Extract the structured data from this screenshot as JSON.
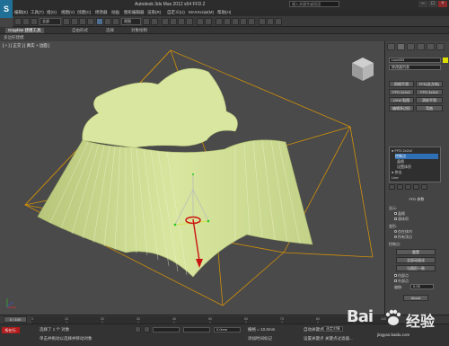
{
  "titlebar": {
    "title": "Autodesk 3ds Max 2012 x64    FFD.2",
    "search_placeholder": "键入关键字或短语",
    "minimize": "–",
    "maximize": "□",
    "close": "×"
  },
  "logo": "S",
  "menubar": [
    "编辑(E)",
    "工具(T)",
    "组(G)",
    "视图(V)",
    "创建(C)",
    "修改器",
    "动画",
    "图形编辑器",
    "渲染(R)",
    "自定义(U)",
    "MAXScript(M)",
    "帮助(H)"
  ],
  "toolbar": {
    "selection_filter": "全部",
    "view_dropdown": "视图"
  },
  "ribbon": {
    "tabs": [
      "Graphite 建模工具",
      "自由形式",
      "选择",
      "对象绘制"
    ]
  },
  "subtitle": "多边形建模",
  "viewport": {
    "label": "[ + ] [ 正交 ] [ 真实 + 边面 ]"
  },
  "command_panel": {
    "object_name": "Line003",
    "modifier_list": "修改器列表",
    "buttons": [
      "网格平滑",
      "FFD(长方体)",
      "FFD 2x2x2",
      "FFD 3x3x3",
      "UVW 贴图",
      "涡轮平滑",
      "编辑多边形",
      "弯曲"
    ],
    "stack": [
      {
        "label": "● FFD 2x2x2",
        "sel": false
      },
      {
        "label": "控制点",
        "sel": true
      },
      {
        "label": "晶格",
        "sel": false
      },
      {
        "label": "设置体积",
        "sel": false
      },
      {
        "label": "● 挤出",
        "sel": false
      },
      {
        "label": "Line",
        "sel": false
      }
    ],
    "ffd_params": {
      "title": "FFD 参数",
      "display_label": "显示:",
      "lattice": "晶格",
      "source_volume": "源体积",
      "deform_label": "变形:",
      "only_in_volume": "仅在体内",
      "all_vertices": "所有顶点",
      "control_points_label": "控制点:",
      "reset": "重置",
      "animate_all": "全部动画化",
      "conform": "与图形一致",
      "inside_points": "内部点",
      "outside_points": "外部点",
      "offset_label": "偏移:",
      "offset_value": "0.05",
      "about": "About"
    }
  },
  "timeline": {
    "slider_label": "0 / 100",
    "ticks": [
      "0",
      "10",
      "20",
      "30",
      "40",
      "50",
      "60",
      "70",
      "80",
      "90",
      "100"
    ]
  },
  "statusbar": {
    "mode": "所在行:",
    "selection_info": "选择了 1 个 对象",
    "prompt": "单击并拖动以选择并移动对象",
    "x_value": "",
    "y_value": "",
    "z_value": "0.0mm",
    "grid": "栅格 = 10.0mm",
    "auto_key": "自动关键点",
    "selected": "选定对象",
    "set_key": "设置关键点",
    "key_filter": "关键点过滤器...",
    "add_time_tag": "添加时间标记"
  },
  "watermark": {
    "brand": "Bai",
    "brand2": "经验",
    "url": "jingyan.baidu.com"
  },
  "colors": {
    "mesh_fill": "#d9e6a0",
    "mesh_line": "#f2f7d8",
    "lattice": "#d0900a",
    "selection_blue": "#2e6fb5",
    "gizmo_red": "#cc1111"
  }
}
